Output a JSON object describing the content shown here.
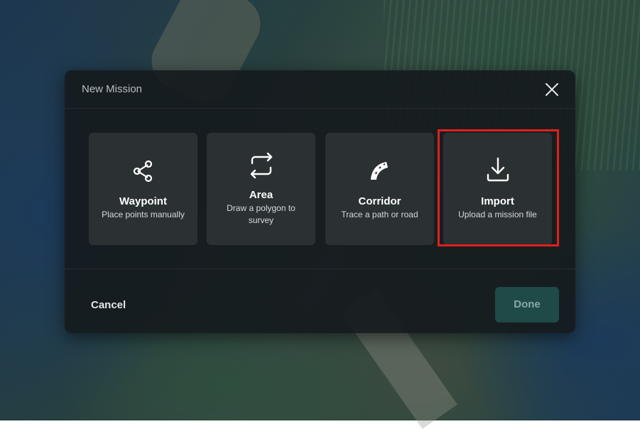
{
  "dialog": {
    "title": "New Mission",
    "close_icon": "close-icon"
  },
  "options": [
    {
      "label": "Waypoint",
      "description": "Place points manually",
      "icon": "share-nodes-icon"
    },
    {
      "label": "Area",
      "description": "Draw a polygon to survey",
      "icon": "arrows-exchange-icon"
    },
    {
      "label": "Corridor",
      "description": "Trace a path or road",
      "icon": "road-curve-icon"
    },
    {
      "label": "Import",
      "description": "Upload a mission file",
      "icon": "download-icon"
    }
  ],
  "highlighted_option": "Import",
  "footer": {
    "cancel_label": "Cancel",
    "done_label": "Done"
  },
  "colors": {
    "dialog_bg": "#161b1e",
    "card_bg": "#2b3033",
    "highlight_border": "#e0201c",
    "done_bg": "#1f4a47",
    "done_text": "#8aa9a6"
  }
}
